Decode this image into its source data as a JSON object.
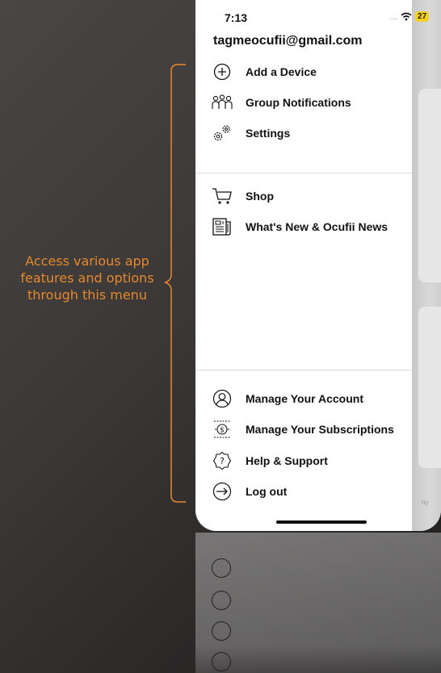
{
  "annotation": {
    "text": "Access various app features and options through this menu",
    "color": "#e5892c"
  },
  "status": {
    "time": "7:13",
    "signal": "....",
    "battery": "27"
  },
  "account": {
    "email": "tagmeocufii@gmail.com"
  },
  "menu": {
    "items": [
      {
        "label": "Add a Device",
        "icon": "plus-circle-icon"
      },
      {
        "label": "Group Notifications",
        "icon": "group-people-icon"
      },
      {
        "label": "Settings",
        "icon": "gears-icon"
      },
      {
        "label": "Shop",
        "icon": "cart-icon"
      },
      {
        "label": "What's New & Ocufii News",
        "icon": "newspaper-icon"
      },
      {
        "label": "Manage Your Account",
        "icon": "user-circle-icon"
      },
      {
        "label": "Manage Your Subscriptions",
        "icon": "subscription-icon"
      },
      {
        "label": "Help & Support",
        "icon": "question-icon"
      },
      {
        "label": "Log out",
        "icon": "logout-icon"
      }
    ]
  },
  "background_hint": {
    "text": "ny"
  }
}
